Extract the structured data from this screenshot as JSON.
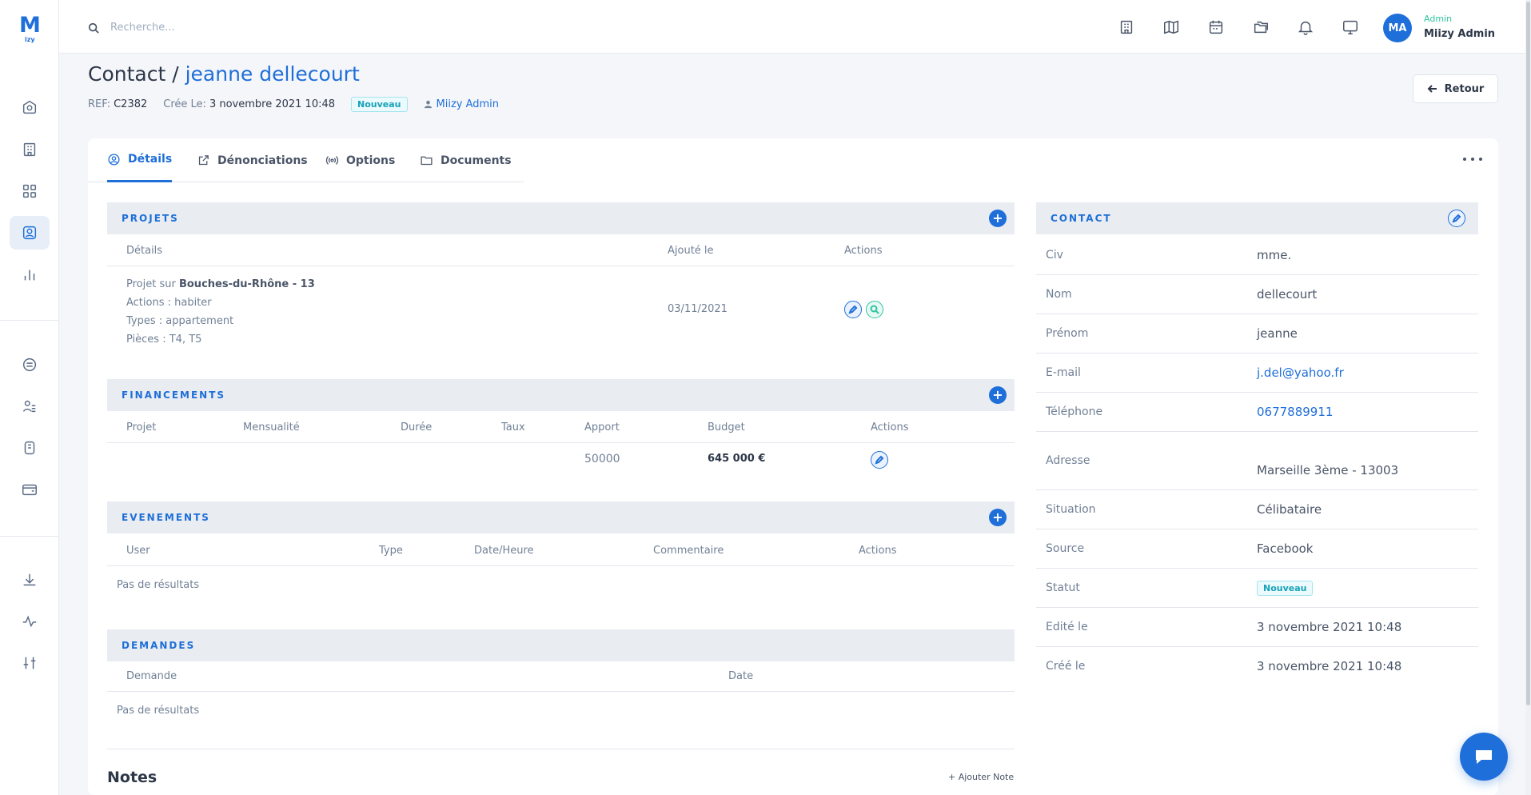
{
  "colors": {
    "accent": "#1e6fd9",
    "teal": "#2ec4a0",
    "badge": "#17a2b8"
  },
  "brand": {
    "logo_main": "M",
    "logo_sub": "izy"
  },
  "sidebar": {
    "items": [
      {
        "icon": "home-shield-icon"
      },
      {
        "icon": "building-icon"
      },
      {
        "icon": "grid-icon"
      },
      {
        "icon": "contact-icon",
        "active": true
      },
      {
        "icon": "bar-chart-icon"
      },
      {
        "icon": "list-circle-icon"
      },
      {
        "icon": "user-list-icon"
      },
      {
        "icon": "clipboard-icon"
      },
      {
        "icon": "wallet-icon"
      },
      {
        "icon": "download-icon"
      },
      {
        "icon": "activity-icon"
      },
      {
        "icon": "sliders-icon"
      }
    ]
  },
  "topbar": {
    "search_placeholder": "Recherche...",
    "icons": [
      "building-icon",
      "map-icon",
      "calendar-icon",
      "folders-icon",
      "bell-icon",
      "monitor-icon"
    ],
    "user": {
      "initials": "MA",
      "role": "Admin",
      "name": "Miizy Admin"
    }
  },
  "header": {
    "title_prefix": "Contact /",
    "title_name": "jeanne dellecourt",
    "ref_label": "REF:",
    "ref_value": "C2382",
    "created_label": "Crée Le:",
    "created_value": "3 novembre 2021 10:48",
    "status": "Nouveau",
    "owner": "Miizy Admin",
    "back_label": "Retour"
  },
  "tabs": [
    {
      "label": "Détails",
      "icon": "user-circle-icon",
      "active": true
    },
    {
      "label": "Dénonciations",
      "icon": "external-link-icon"
    },
    {
      "label": "Options",
      "icon": "broadcast-icon"
    },
    {
      "label": "Documents",
      "icon": "folder-icon"
    }
  ],
  "projets": {
    "title": "PROJETS",
    "columns": [
      "Détails",
      "Ajouté le",
      "Actions"
    ],
    "row": {
      "line1_prefix": "Projet sur",
      "line1_bold": "Bouches-du-Rhône - 13",
      "line2": "Actions : habiter",
      "line3": "Types : appartement",
      "line4": "Pièces : T4, T5",
      "date": "03/11/2021"
    }
  },
  "financements": {
    "title": "FINANCEMENTS",
    "columns": [
      "Projet",
      "Mensualité",
      "Durée",
      "Taux",
      "Apport",
      "Budget",
      "Actions"
    ],
    "row": {
      "apport": "50000",
      "budget": "645 000 €"
    }
  },
  "evenements": {
    "title": "EVENEMENTS",
    "columns": [
      "User",
      "Type",
      "Date/Heure",
      "Commentaire",
      "Actions"
    ],
    "empty": "Pas de résultats"
  },
  "demandes": {
    "title": "DEMANDES",
    "columns": [
      "Demande",
      "Date"
    ],
    "empty": "Pas de résultats"
  },
  "notes": {
    "title": "Notes",
    "add_label": "+ Ajouter Note"
  },
  "contact": {
    "title": "CONTACT",
    "fields": [
      {
        "label": "Civ",
        "value": "mme."
      },
      {
        "label": "Nom",
        "value": "dellecourt"
      },
      {
        "label": "Prénom",
        "value": "jeanne"
      },
      {
        "label": "E-mail",
        "value": "j.del@yahoo.fr"
      },
      {
        "label": "Téléphone",
        "value": "0677889911"
      },
      {
        "label": "Adresse",
        "value": "Marseille 3ème - 13003"
      },
      {
        "label": "Situation",
        "value": "Célibataire"
      },
      {
        "label": "Source",
        "value": "Facebook"
      },
      {
        "label": "Statut",
        "value": "Nouveau"
      },
      {
        "label": "Edité le",
        "value": "3 novembre 2021 10:48"
      },
      {
        "label": "Créé le",
        "value": "3 novembre 2021 10:48"
      }
    ]
  }
}
